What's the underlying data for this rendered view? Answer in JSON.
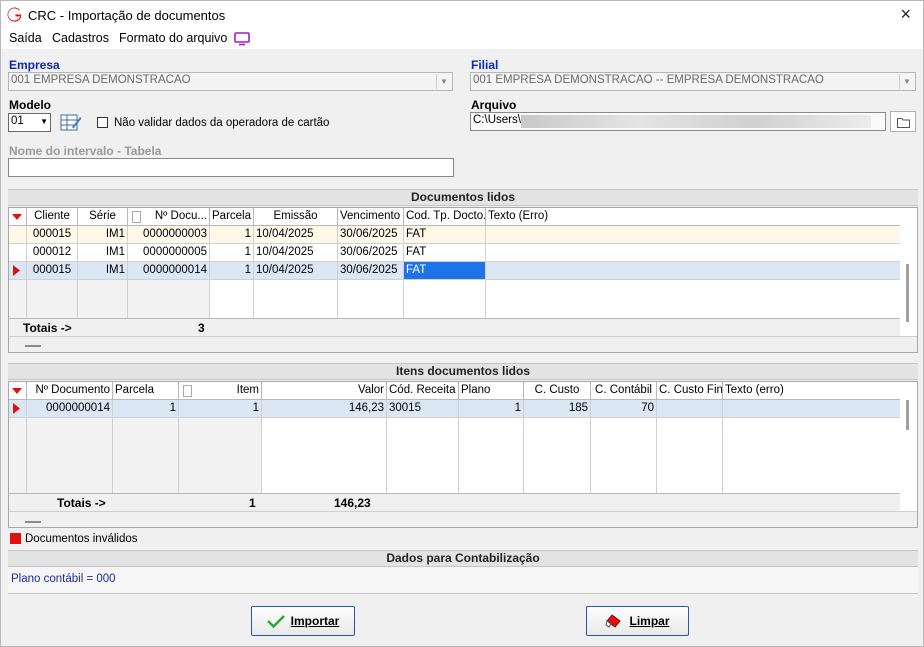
{
  "window": {
    "title": "CRC - Importação de documentos",
    "close": "×"
  },
  "menu": [
    "Saída",
    "Cadastros",
    "Formato do arquivo"
  ],
  "empresa": {
    "label": "Empresa",
    "value": "001 EMPRESA DEMONSTRACAO"
  },
  "filial": {
    "label": "Filial",
    "value": "001 EMPRESA DEMONSTRACAO -- EMPRESA DEMONSTRACAO"
  },
  "modelo": {
    "label": "Modelo",
    "value": "01"
  },
  "validar": {
    "label": "Não validar dados da operadora de cartão",
    "checked": false
  },
  "arquivo": {
    "label": "Arquivo",
    "value": "C:\\Users\\"
  },
  "intervalo": {
    "label": "Nome do intervalo - Tabela",
    "value": ""
  },
  "docs": {
    "title": "Documentos lidos",
    "columns": [
      "Cliente",
      "Série",
      "Nº Docu...",
      "Parcela",
      "Emissão",
      "Vencimento",
      "Cod. Tp. Docto.",
      "Texto (Erro)"
    ],
    "rows": [
      [
        "000015",
        "IM1",
        "0000000003",
        "1",
        "10/04/2025",
        "30/06/2025",
        "FAT",
        ""
      ],
      [
        "000012",
        "IM1",
        "0000000005",
        "1",
        "10/04/2025",
        "30/06/2025",
        "FAT",
        ""
      ],
      [
        "000015",
        "IM1",
        "0000000014",
        "1",
        "10/04/2025",
        "30/06/2025",
        "FAT",
        ""
      ]
    ],
    "totals_label": "Totais ->",
    "totals_value": "3"
  },
  "items": {
    "title": "Itens documentos lidos",
    "columns": [
      "Nº Documento",
      "Parcela",
      "Item",
      "Valor",
      "Cód. Receita",
      "Plano",
      "C. Custo",
      "C. Contábil",
      "C. Custo Fin.",
      "Texto (erro)"
    ],
    "rows": [
      [
        "0000000014",
        "1",
        "1",
        "146,23",
        "30015",
        "1",
        "185",
        "70",
        "",
        ""
      ]
    ],
    "totals_label": "Totais ->",
    "totals_count": "1",
    "totals_valor": "146,23"
  },
  "legend": {
    "label": "Documentos inválidos",
    "color": "#e01010"
  },
  "contab": {
    "title": "Dados para Contabilização",
    "text": "Plano contábil = 000"
  },
  "buttons": {
    "importar": "Importar",
    "limpar": "Limpar"
  },
  "colors": {
    "accent_blue": "#0a2bb5",
    "selection": "#1c74e6",
    "row_selected": "#dce7f5",
    "red": "#e01010"
  }
}
